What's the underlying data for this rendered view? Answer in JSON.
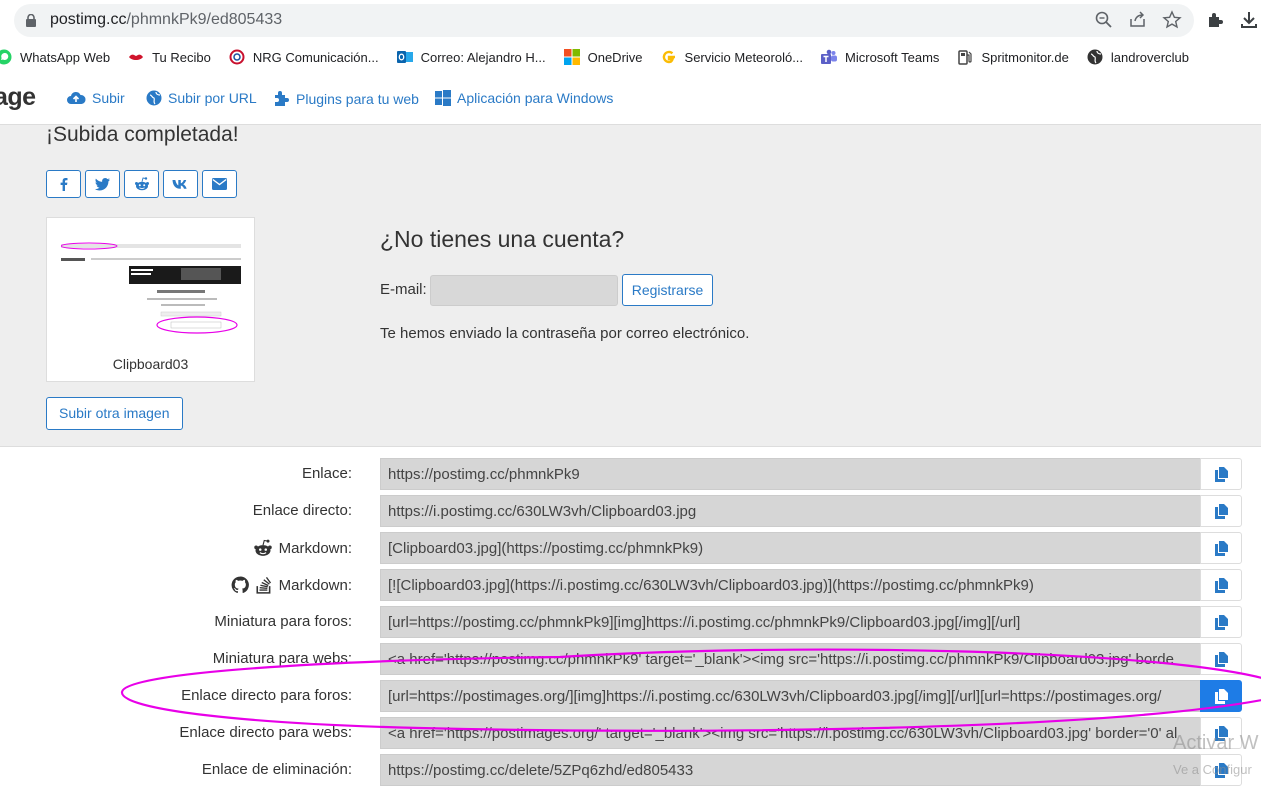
{
  "browser": {
    "url_host": "postimg.cc",
    "url_path": "/phmnkPk9/ed805433",
    "omnibox_icons": [
      "zoom-icon",
      "share-icon",
      "star-icon"
    ],
    "toolbar_icons": [
      "extensions-icon",
      "download-icon"
    ]
  },
  "bookmarks": [
    {
      "label": "WhatsApp Web",
      "icon": "whatsapp-icon",
      "color": "#25d366"
    },
    {
      "label": "Tu Recibo",
      "icon": "lips-icon",
      "color": "#d0142c"
    },
    {
      "label": "NRG Comunicación...",
      "icon": "nrg-icon",
      "color": "#c8102e"
    },
    {
      "label": "Correo: Alejandro H...",
      "icon": "outlook-icon",
      "color": "#0a64ad"
    },
    {
      "label": "OneDrive",
      "icon": "microsoft-icon",
      "color": "#f25022"
    },
    {
      "label": "Servicio Meteoroló...",
      "icon": "google-icon",
      "color": "#fbbc05"
    },
    {
      "label": "Microsoft Teams",
      "icon": "teams-icon",
      "color": "#5b5fc7"
    },
    {
      "label": "Spritmonitor.de",
      "icon": "fuel-icon",
      "color": "#444444"
    },
    {
      "label": "landroverclub",
      "icon": "globe-icon",
      "color": "#333333"
    }
  ],
  "nav": {
    "logo_text": "age",
    "links": [
      {
        "label": "Subir",
        "icon": "cloud-upload-icon"
      },
      {
        "label": "Subir por URL",
        "icon": "globe-icon"
      },
      {
        "label": "Plugins para tu web",
        "icon": "puzzle-icon"
      },
      {
        "label": "Aplicación para Windows",
        "icon": "windows-icon"
      }
    ]
  },
  "upload": {
    "title": "¡Subida completada!",
    "share_buttons": [
      "facebook-icon",
      "twitter-icon",
      "reddit-icon",
      "vk-icon",
      "envelope-icon"
    ],
    "thumbnail_name": "Clipboard03",
    "another_button": "Subir otra imagen"
  },
  "account": {
    "title": "¿No tienes una cuenta?",
    "email_label": "E-mail:",
    "email_value": "",
    "register_button": "Registrarse",
    "sent_message": "Te hemos enviado la contraseña por correo electrónico."
  },
  "links": [
    {
      "label": "Enlace:",
      "value": "https://postimg.cc/phmnkPk9",
      "icon": null
    },
    {
      "label": "Enlace directo:",
      "value": "https://i.postimg.cc/630LW3vh/Clipboard03.jpg",
      "icon": null
    },
    {
      "label": "Markdown:",
      "value": "[Clipboard03.jpg](https://postimg.cc/phmnkPk9)",
      "icon": "reddit-icon"
    },
    {
      "label": "Markdown:",
      "value": "[![Clipboard03.jpg](https://i.postimg.cc/630LW3vh/Clipboard03.jpg)](https://postimg.cc/phmnkPk9)",
      "icon": "github-stackoverflow-icon"
    },
    {
      "label": "Miniatura para foros:",
      "value": "[url=https://postimg.cc/phmnkPk9][img]https://i.postimg.cc/phmnkPk9/Clipboard03.jpg[/img][/url]",
      "icon": null
    },
    {
      "label": "Miniatura para webs:",
      "value": "<a href='https://postimg.cc/phmnkPk9' target='_blank'><img src='https://i.postimg.cc/phmnkPk9/Clipboard03.jpg' borde",
      "icon": null
    },
    {
      "label": "Enlace directo para foros:",
      "value": "[url=https://postimages.org/][img]https://i.postimg.cc/630LW3vh/Clipboard03.jpg[/img][/url][url=https://postimages.org/",
      "icon": null,
      "active": true
    },
    {
      "label": "Enlace directo para webs:",
      "value": "<a href='https://postimages.org/' target='_blank'><img src='https://i.postimg.cc/630LW3vh/Clipboard03.jpg' border='0' al",
      "icon": null
    },
    {
      "label": "Enlace de eliminación:",
      "value": "https://postimg.cc/delete/5ZPq6zhd/ed805433",
      "icon": null
    }
  ],
  "watermark": {
    "line1": "Activar W",
    "line2": "Ve a Configur"
  },
  "colors": {
    "accent": "#2a7ac6",
    "copy_active": "#1e7ce6",
    "annotation": "#e800e8"
  }
}
